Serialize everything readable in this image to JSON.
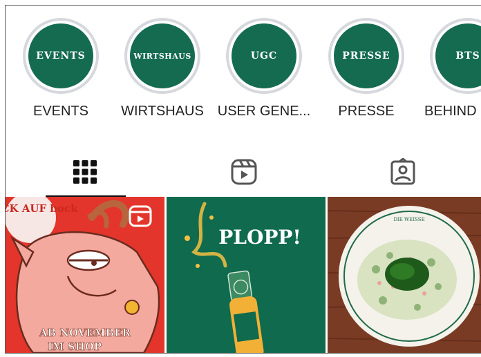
{
  "highlights": [
    {
      "cover_text": "EVENTS",
      "label": "EVENTS"
    },
    {
      "cover_text": "WIRTSHAUS",
      "label": "WIRTSHAUS"
    },
    {
      "cover_text": "UGC",
      "label": "USER GENE..."
    },
    {
      "cover_text": "PRESSE",
      "label": "PRESSE"
    },
    {
      "cover_text": "BTS",
      "label": "BEHIND"
    }
  ],
  "tabs": [
    {
      "icon": "grid-icon",
      "active": true
    },
    {
      "icon": "reels-icon",
      "active": false
    },
    {
      "icon": "tagged-icon",
      "active": false
    }
  ],
  "posts": [
    {
      "text_top": "BOCK AUF bock",
      "text_bottom_1": "AB NOVEMBER",
      "text_bottom_2": "IM SHOP",
      "badge": "reels-badge-icon",
      "color": "#e3352b"
    },
    {
      "headline": "PLOPP!",
      "color": "#0f6a4e"
    },
    {
      "plate_text": "DIE WEISSE",
      "color": "#7a3b24"
    }
  ],
  "colors": {
    "brand_green": "#146b4f",
    "ring": "#d6d8de",
    "red": "#e3352b"
  }
}
